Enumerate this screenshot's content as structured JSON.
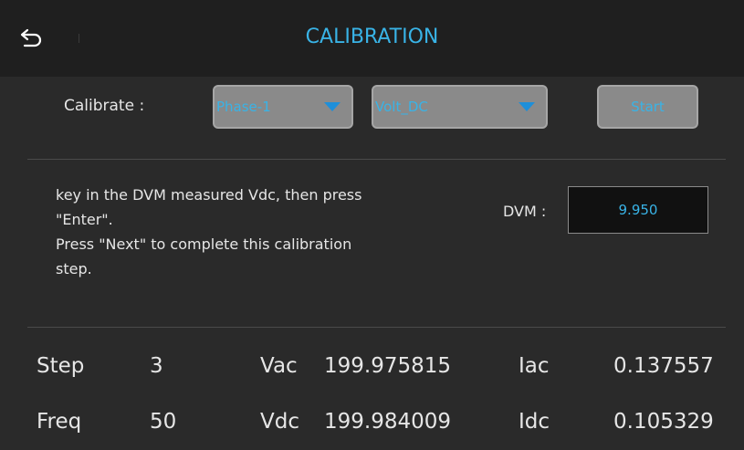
{
  "header": {
    "title": "CALIBRATION",
    "back_icon": "undo-arrow-icon",
    "title_color": "#39b3e6"
  },
  "calibrate": {
    "label": "Calibrate :",
    "phase_select": "Phase-1",
    "mode_select": "Volt_DC",
    "start_label": "Start"
  },
  "instructions": {
    "line1": "key in the DVM measured Vdc, then press",
    "line2": "\"Enter\".",
    "line3": "Press \"Next\" to complete this calibration",
    "line4": "step."
  },
  "dvm": {
    "label": "DVM :",
    "value": "9.950"
  },
  "stats": {
    "step_label": "Step",
    "step_value": "3",
    "freq_label": "Freq",
    "freq_value": "50",
    "vac_label": "Vac",
    "vac_value": "199.975815",
    "vdc_label": "Vdc",
    "vdc_value": "199.984009",
    "iac_label": "Iac",
    "iac_value": "0.137557",
    "idc_label": "Idc",
    "idc_value": "0.105329"
  }
}
